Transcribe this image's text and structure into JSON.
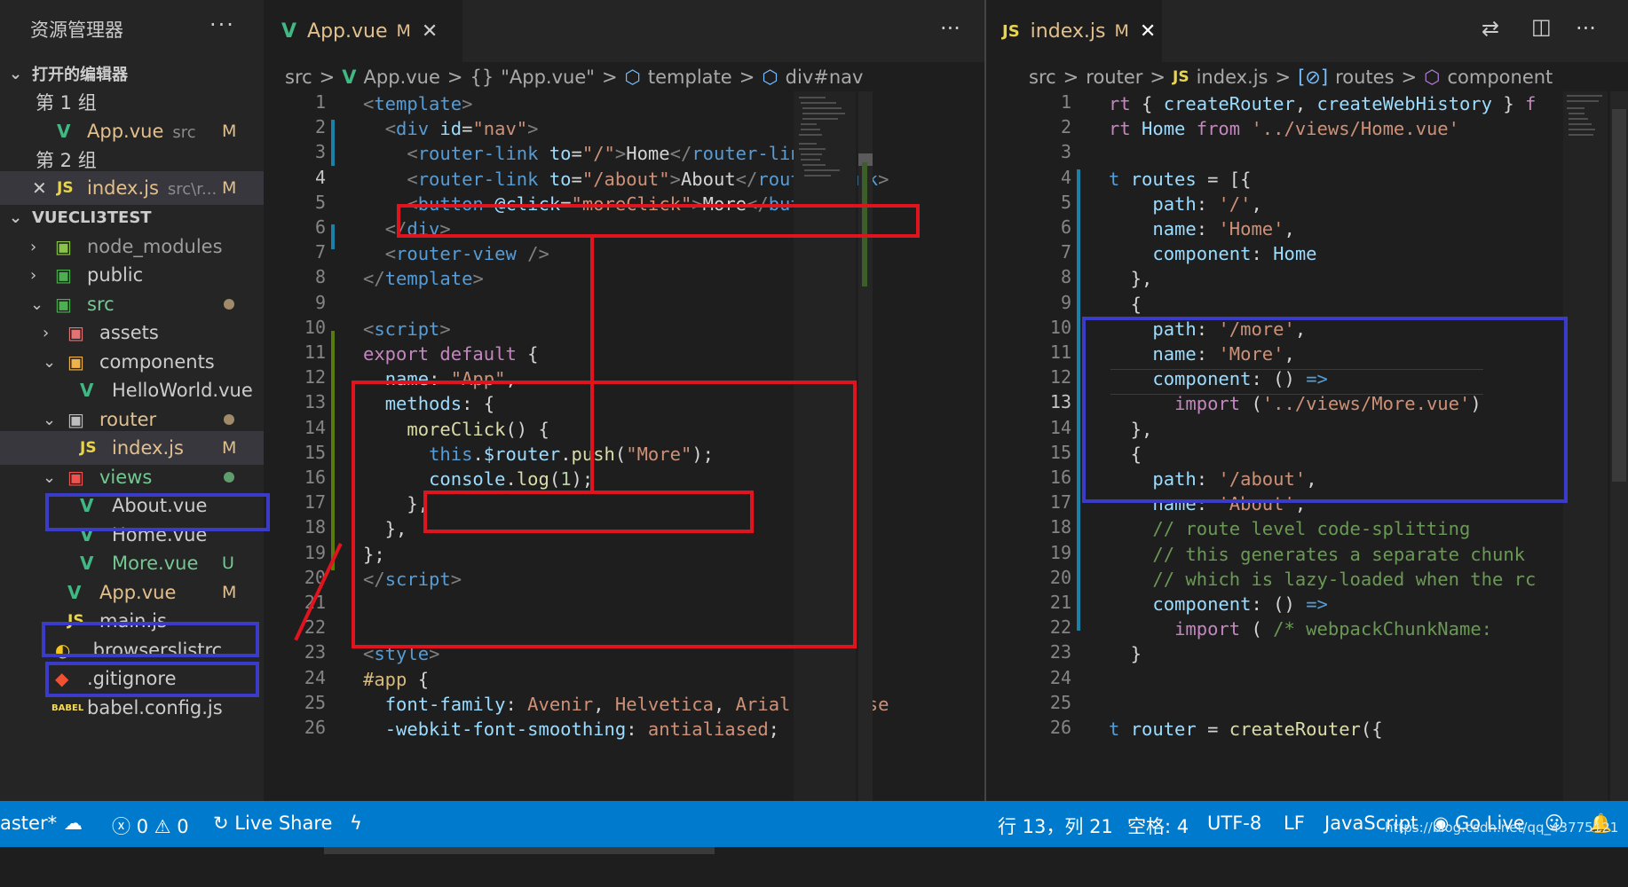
{
  "sidebar": {
    "title": "资源管理器",
    "more": "···",
    "open_editors_header": "打开的编辑器",
    "group1_label": "第 1 组",
    "group1_file": {
      "icon": "V",
      "name": "App.vue",
      "path": "src",
      "badge": "M"
    },
    "group2_label": "第 2 组",
    "group2_file": {
      "close": "✕",
      "icon": "JS",
      "name": "index.js",
      "path": "src\\r...",
      "badge": "M"
    },
    "project_header": "VUECLI3TEST",
    "tree": [
      {
        "name": "node_modules"
      },
      {
        "name": "public"
      },
      {
        "name": "src"
      },
      {
        "name": "assets"
      },
      {
        "name": "components"
      },
      {
        "name": "HelloWorld.vue",
        "icon": "V"
      },
      {
        "name": "router"
      },
      {
        "name": "index.js",
        "icon": "JS",
        "badge": "M"
      },
      {
        "name": "views"
      },
      {
        "name": "About.vue",
        "icon": "V"
      },
      {
        "name": "Home.vue",
        "icon": "V"
      },
      {
        "name": "More.vue",
        "icon": "V",
        "badge": "U"
      },
      {
        "name": "App.vue",
        "icon": "V",
        "badge": "M"
      },
      {
        "name": "main.js",
        "icon": "JS"
      },
      {
        "name": ".browserslistrc"
      },
      {
        "name": ".gitignore"
      },
      {
        "name": "babel.config.js",
        "icon": "BABEL"
      }
    ]
  },
  "left_editor": {
    "tab": {
      "icon": "V",
      "name": "App.vue",
      "badge": "M",
      "close": "✕"
    },
    "more": "···",
    "breadcrumb": [
      "src",
      ">",
      "V",
      "App.vue",
      ">",
      "{}",
      "\"App.vue\"",
      ">",
      "template",
      ">",
      "div#nav"
    ],
    "line_numbers": [
      "1",
      "2",
      "3",
      "4",
      "5",
      "6",
      "7",
      "8",
      "9",
      "10",
      "11",
      "12",
      "13",
      "14",
      "15",
      "16",
      "17",
      "18",
      "19",
      "20",
      "21",
      "22",
      "23",
      "24",
      "25",
      "26"
    ],
    "current_line": "4"
  },
  "right_editor": {
    "tab": {
      "icon": "JS",
      "name": "index.js",
      "badge": "M",
      "close": "✕"
    },
    "more": "···",
    "breadcrumb": [
      "src",
      ">",
      "router",
      ">",
      "JS",
      "index.js",
      ">",
      "routes",
      ">",
      "component"
    ],
    "line_numbers": [
      "1",
      "2",
      "3",
      "4",
      "5",
      "6",
      "7",
      "8",
      "9",
      "10",
      "11",
      "12",
      "13",
      "14",
      "15",
      "16",
      "17",
      "18",
      "19",
      "20",
      "21",
      "22",
      "23",
      "24",
      "25",
      "26"
    ],
    "current_line": "13"
  },
  "statusbar": {
    "branch": "aster*",
    "errors": "0",
    "warnings": "0",
    "live_share": "Live Share",
    "position": "行 13，列 21",
    "spaces": "空格: 4",
    "encoding": "UTF-8",
    "eol": "LF",
    "language": "JavaScript",
    "go_live": "Go Live"
  },
  "watermark": "https://blog.csdn.net/qq_43775121",
  "colors": {
    "accent": "#007acc",
    "highlight_red": "#e0141e",
    "highlight_blue": "#3b3bc9"
  }
}
